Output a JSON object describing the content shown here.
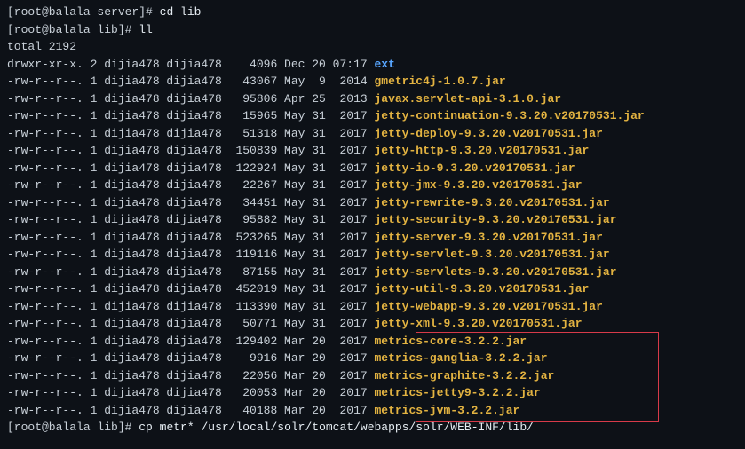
{
  "prompt1_user": "[root@balala server]#",
  "prompt1_cmd": "cd lib",
  "prompt2_user": "[root@balala lib]#",
  "prompt2_cmd": "ll",
  "total": "total 2192",
  "rows": [
    {
      "perm": "drwxr-xr-x.",
      "links": "2",
      "owner": "dijia478",
      "group": "dijia478",
      "size": "   4096",
      "date": "Dec 20 07:17",
      "name": "ext",
      "type": "dir"
    },
    {
      "perm": "-rw-r--r--.",
      "links": "1",
      "owner": "dijia478",
      "group": "dijia478",
      "size": "  43067",
      "date": "May  9  2014",
      "name": "gmetric4j-1.0.7.jar",
      "type": "jar"
    },
    {
      "perm": "-rw-r--r--.",
      "links": "1",
      "owner": "dijia478",
      "group": "dijia478",
      "size": "  95806",
      "date": "Apr 25  2013",
      "name": "javax.servlet-api-3.1.0.jar",
      "type": "jar"
    },
    {
      "perm": "-rw-r--r--.",
      "links": "1",
      "owner": "dijia478",
      "group": "dijia478",
      "size": "  15965",
      "date": "May 31  2017",
      "name": "jetty-continuation-9.3.20.v20170531.jar",
      "type": "jar"
    },
    {
      "perm": "-rw-r--r--.",
      "links": "1",
      "owner": "dijia478",
      "group": "dijia478",
      "size": "  51318",
      "date": "May 31  2017",
      "name": "jetty-deploy-9.3.20.v20170531.jar",
      "type": "jar"
    },
    {
      "perm": "-rw-r--r--.",
      "links": "1",
      "owner": "dijia478",
      "group": "dijia478",
      "size": " 150839",
      "date": "May 31  2017",
      "name": "jetty-http-9.3.20.v20170531.jar",
      "type": "jar"
    },
    {
      "perm": "-rw-r--r--.",
      "links": "1",
      "owner": "dijia478",
      "group": "dijia478",
      "size": " 122924",
      "date": "May 31  2017",
      "name": "jetty-io-9.3.20.v20170531.jar",
      "type": "jar"
    },
    {
      "perm": "-rw-r--r--.",
      "links": "1",
      "owner": "dijia478",
      "group": "dijia478",
      "size": "  22267",
      "date": "May 31  2017",
      "name": "jetty-jmx-9.3.20.v20170531.jar",
      "type": "jar"
    },
    {
      "perm": "-rw-r--r--.",
      "links": "1",
      "owner": "dijia478",
      "group": "dijia478",
      "size": "  34451",
      "date": "May 31  2017",
      "name": "jetty-rewrite-9.3.20.v20170531.jar",
      "type": "jar"
    },
    {
      "perm": "-rw-r--r--.",
      "links": "1",
      "owner": "dijia478",
      "group": "dijia478",
      "size": "  95882",
      "date": "May 31  2017",
      "name": "jetty-security-9.3.20.v20170531.jar",
      "type": "jar"
    },
    {
      "perm": "-rw-r--r--.",
      "links": "1",
      "owner": "dijia478",
      "group": "dijia478",
      "size": " 523265",
      "date": "May 31  2017",
      "name": "jetty-server-9.3.20.v20170531.jar",
      "type": "jar"
    },
    {
      "perm": "-rw-r--r--.",
      "links": "1",
      "owner": "dijia478",
      "group": "dijia478",
      "size": " 119116",
      "date": "May 31  2017",
      "name": "jetty-servlet-9.3.20.v20170531.jar",
      "type": "jar"
    },
    {
      "perm": "-rw-r--r--.",
      "links": "1",
      "owner": "dijia478",
      "group": "dijia478",
      "size": "  87155",
      "date": "May 31  2017",
      "name": "jetty-servlets-9.3.20.v20170531.jar",
      "type": "jar"
    },
    {
      "perm": "-rw-r--r--.",
      "links": "1",
      "owner": "dijia478",
      "group": "dijia478",
      "size": " 452019",
      "date": "May 31  2017",
      "name": "jetty-util-9.3.20.v20170531.jar",
      "type": "jar"
    },
    {
      "perm": "-rw-r--r--.",
      "links": "1",
      "owner": "dijia478",
      "group": "dijia478",
      "size": " 113390",
      "date": "May 31  2017",
      "name": "jetty-webapp-9.3.20.v20170531.jar",
      "type": "jar"
    },
    {
      "perm": "-rw-r--r--.",
      "links": "1",
      "owner": "dijia478",
      "group": "dijia478",
      "size": "  50771",
      "date": "May 31  2017",
      "name": "jetty-xml-9.3.20.v20170531.jar",
      "type": "jar"
    },
    {
      "perm": "-rw-r--r--.",
      "links": "1",
      "owner": "dijia478",
      "group": "dijia478",
      "size": " 129402",
      "date": "Mar 20  2017",
      "name": "metrics-core-3.2.2.jar",
      "type": "jar"
    },
    {
      "perm": "-rw-r--r--.",
      "links": "1",
      "owner": "dijia478",
      "group": "dijia478",
      "size": "   9916",
      "date": "Mar 20  2017",
      "name": "metrics-ganglia-3.2.2.jar",
      "type": "jar"
    },
    {
      "perm": "-rw-r--r--.",
      "links": "1",
      "owner": "dijia478",
      "group": "dijia478",
      "size": "  22056",
      "date": "Mar 20  2017",
      "name": "metrics-graphite-3.2.2.jar",
      "type": "jar"
    },
    {
      "perm": "-rw-r--r--.",
      "links": "1",
      "owner": "dijia478",
      "group": "dijia478",
      "size": "  20053",
      "date": "Mar 20  2017",
      "name": "metrics-jetty9-3.2.2.jar",
      "type": "jar"
    },
    {
      "perm": "-rw-r--r--.",
      "links": "1",
      "owner": "dijia478",
      "group": "dijia478",
      "size": "  40188",
      "date": "Mar 20  2017",
      "name": "metrics-jvm-3.2.2.jar",
      "type": "jar"
    }
  ],
  "prompt3_user": "[root@balala lib]#",
  "prompt3_cmd": "cp metr* /usr/local/solr/tomcat/webapps/solr/WEB-INF/lib/"
}
